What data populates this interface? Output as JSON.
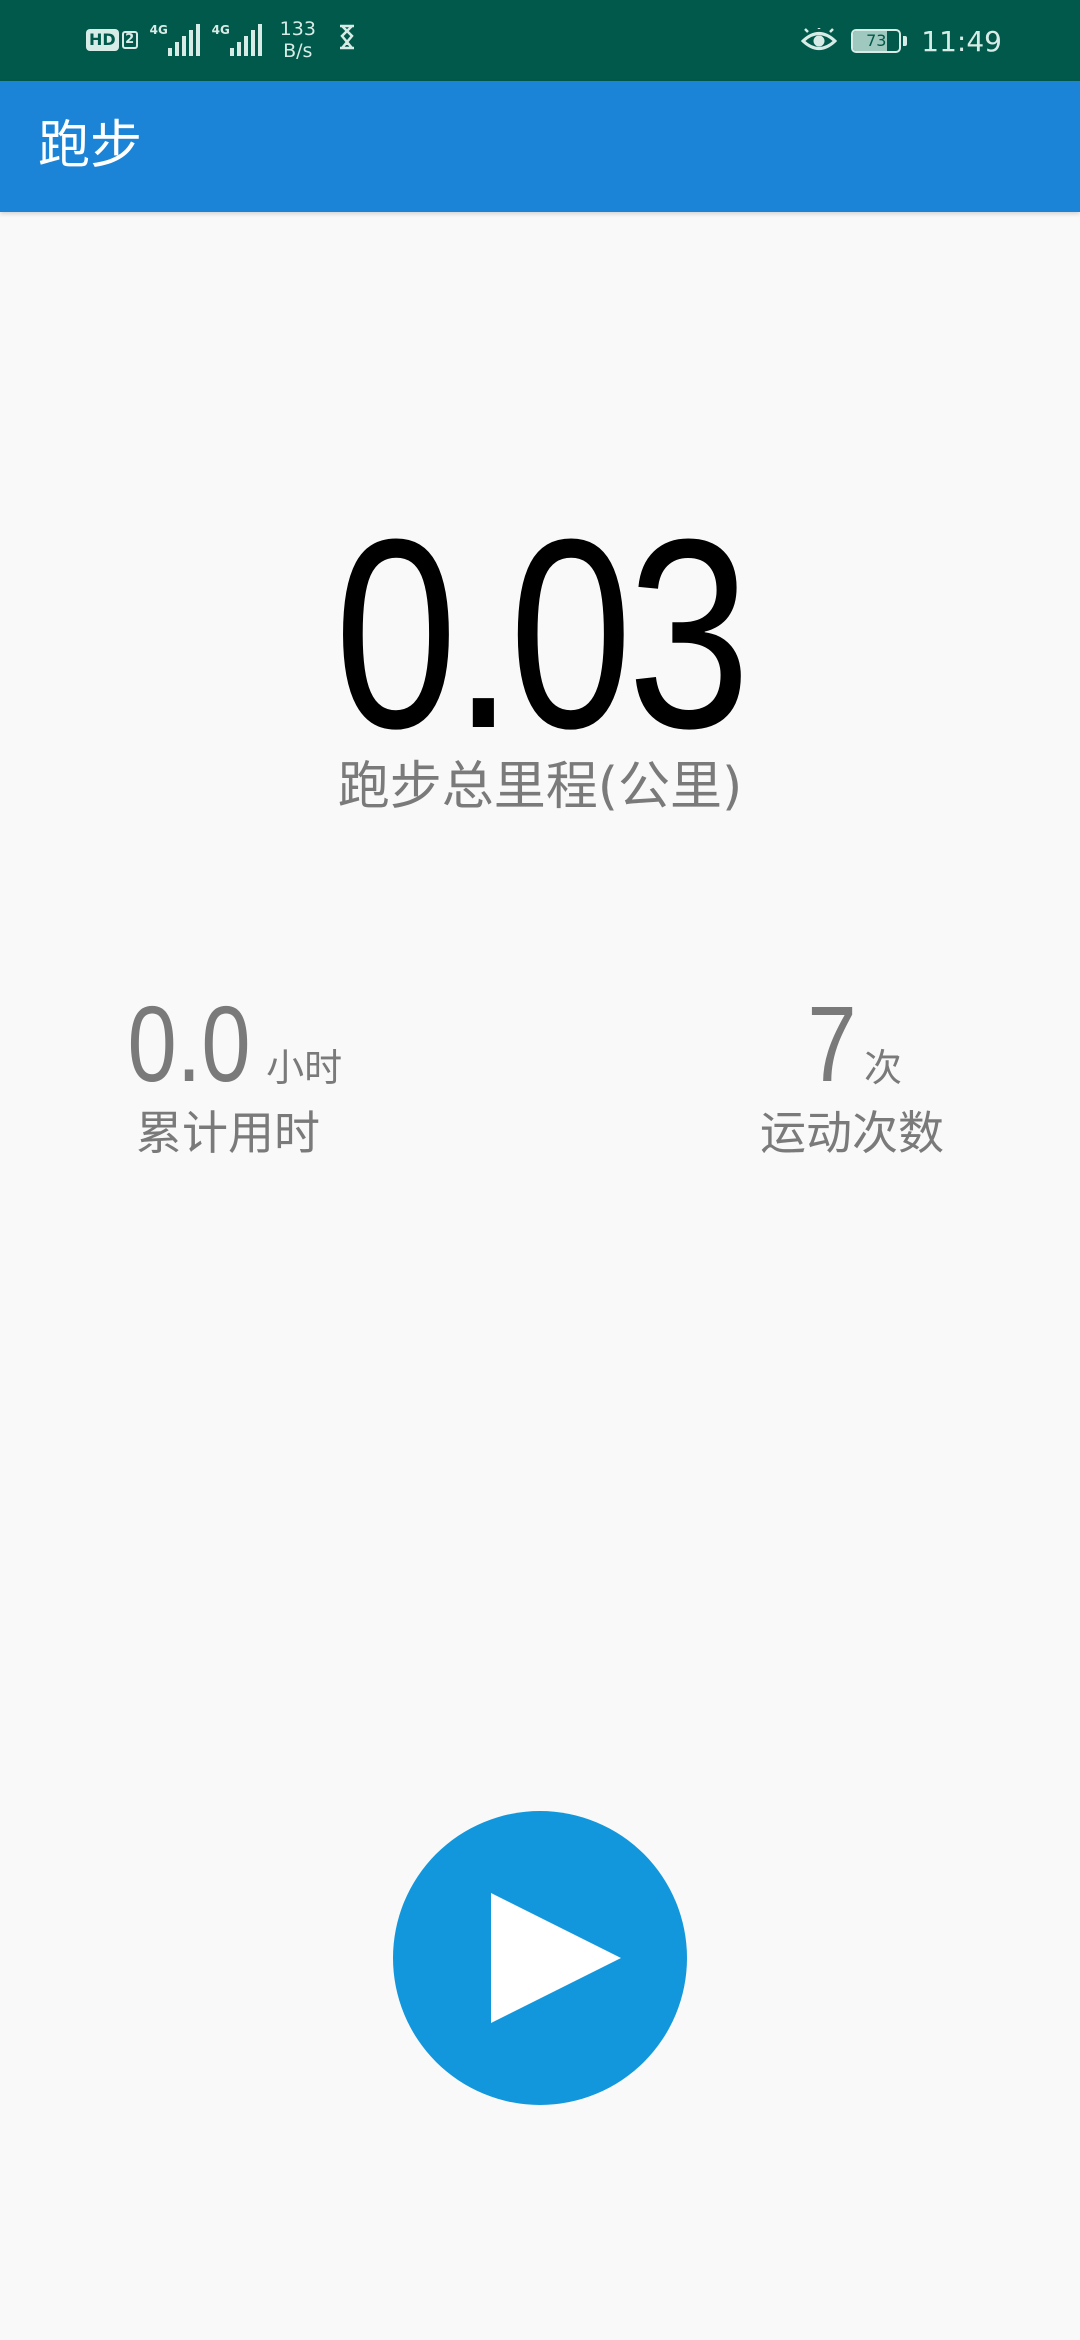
{
  "status_bar": {
    "hd_label": "HD",
    "hd_sub": "2",
    "signal1_net": "4G",
    "signal2_net": "4G",
    "net_speed_value": "133",
    "net_speed_unit": "B/s",
    "battery_level": "73",
    "time": "11:49",
    "icons": [
      "hd-icon",
      "signal-icon",
      "signal-icon",
      "hourglass-icon",
      "eye-icon",
      "battery-icon"
    ]
  },
  "app_bar": {
    "title": "跑步"
  },
  "summary": {
    "total_distance": "0.03",
    "total_distance_label": "跑步总里程(公里)"
  },
  "stats": {
    "time": {
      "value": "0.0",
      "unit": "小时",
      "label": "累计用时"
    },
    "count": {
      "value": "7",
      "unit": "次",
      "label": "运动次数"
    }
  },
  "actions": {
    "start_icon": "play-icon"
  },
  "colors": {
    "status_bar_bg": "#00594a",
    "app_bar_bg": "#1b84d6",
    "start_button_bg": "#1297dc",
    "page_bg": "#f9f9f9",
    "secondary_text": "#7a7a7a"
  }
}
